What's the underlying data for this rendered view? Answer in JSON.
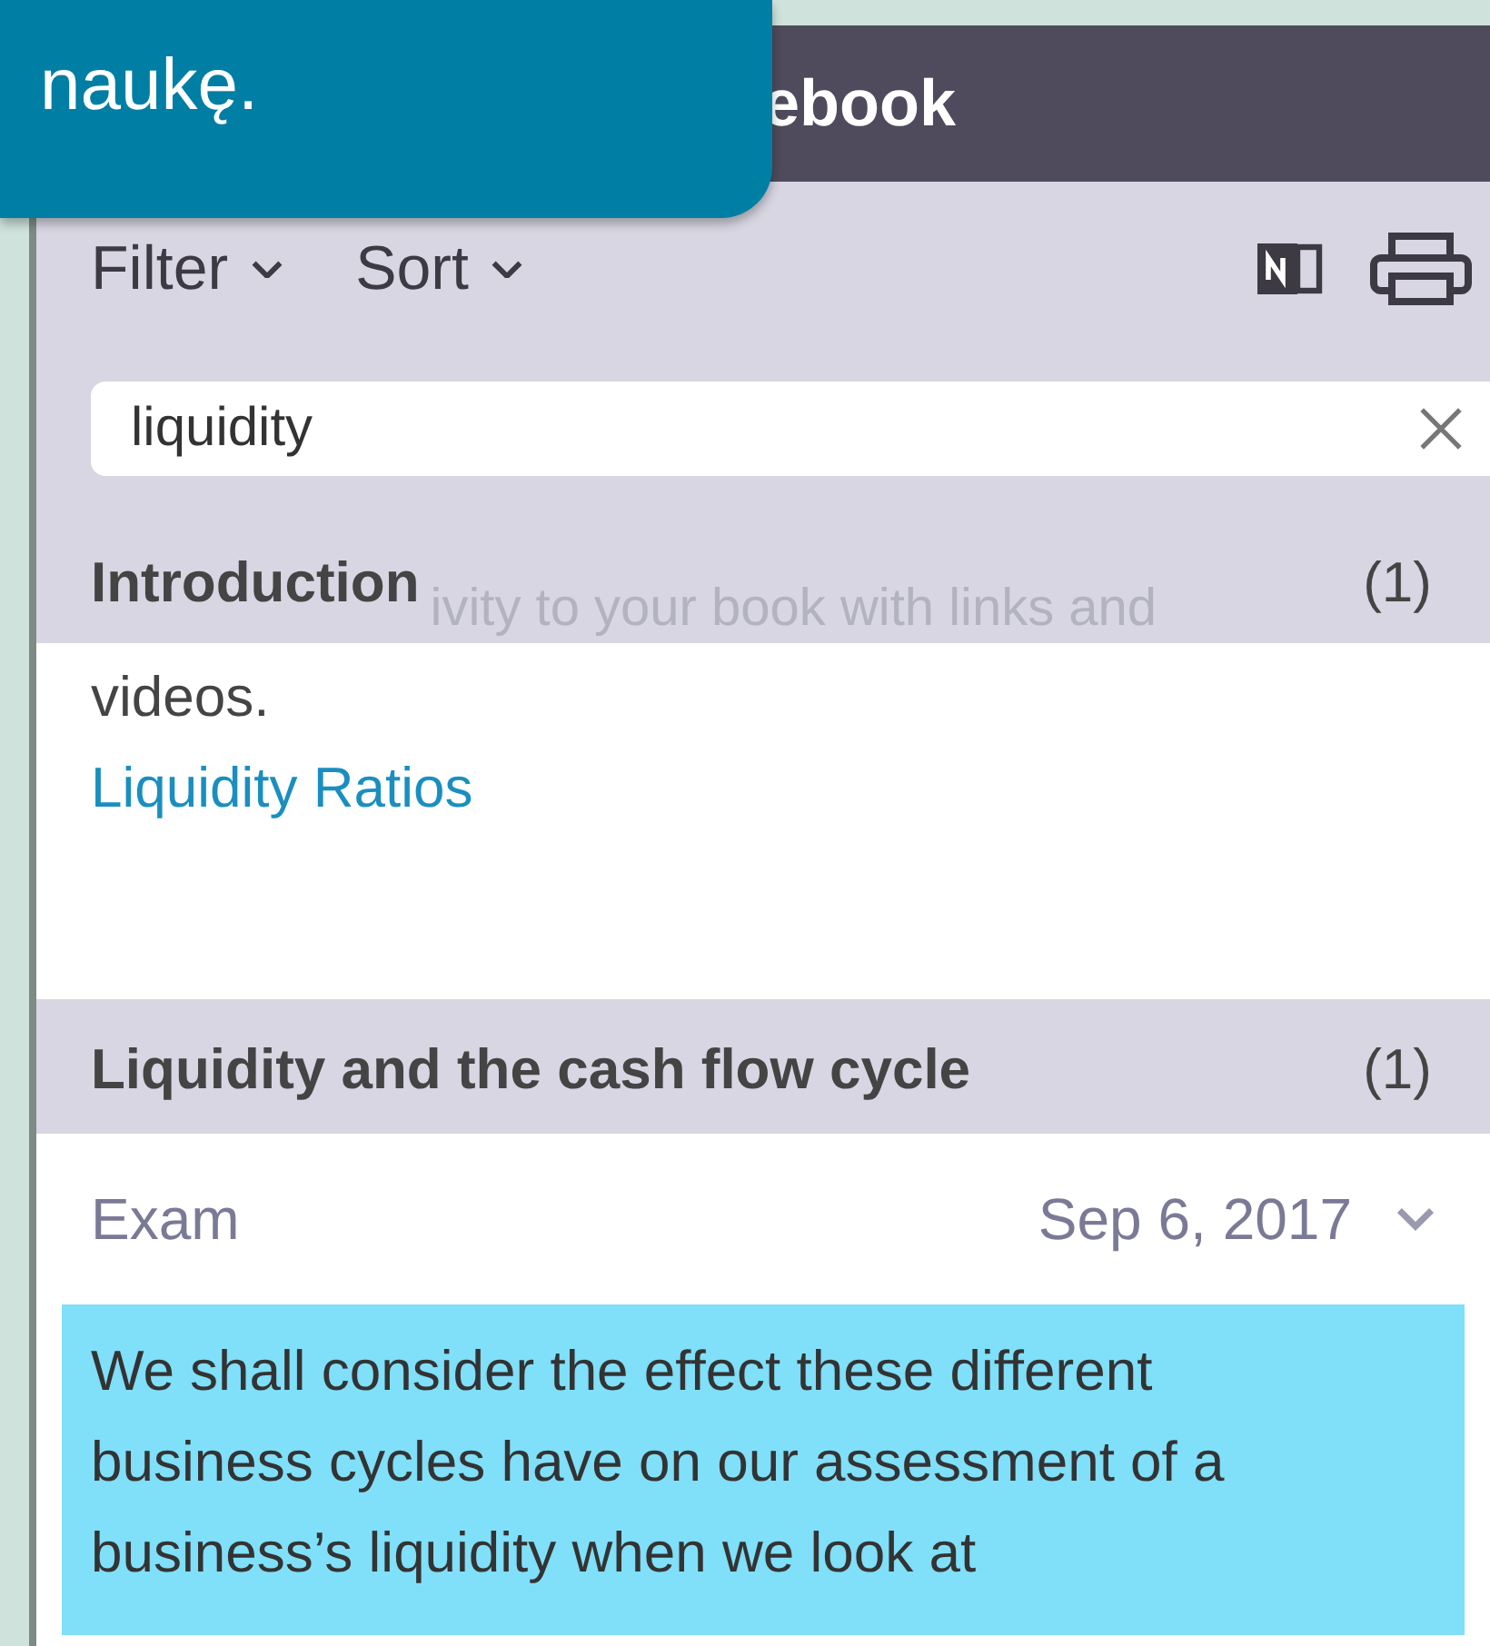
{
  "tooltip": {
    "text": "naukę."
  },
  "window": {
    "title": "ebook"
  },
  "toolbar": {
    "menus": [
      {
        "label": "Filter"
      },
      {
        "label": "Sort"
      }
    ]
  },
  "search": {
    "value": "liquidity"
  },
  "groups": [
    {
      "title": "Introduction",
      "count": "(1)",
      "faded_text": "ivity to your book with links and",
      "lines": [
        {
          "kind": "text",
          "text": "videos."
        },
        {
          "kind": "link",
          "text": "Liquidity Ratios"
        }
      ]
    },
    {
      "title": "Liquidity and the cash flow cycle",
      "count": "(1)",
      "entry": {
        "tag": "Exam",
        "date": "Sep 6, 2017",
        "highlight": "We shall consider the effect these different business cycles have on our assessment of a business’s liquidity when we look at"
      }
    }
  ]
}
